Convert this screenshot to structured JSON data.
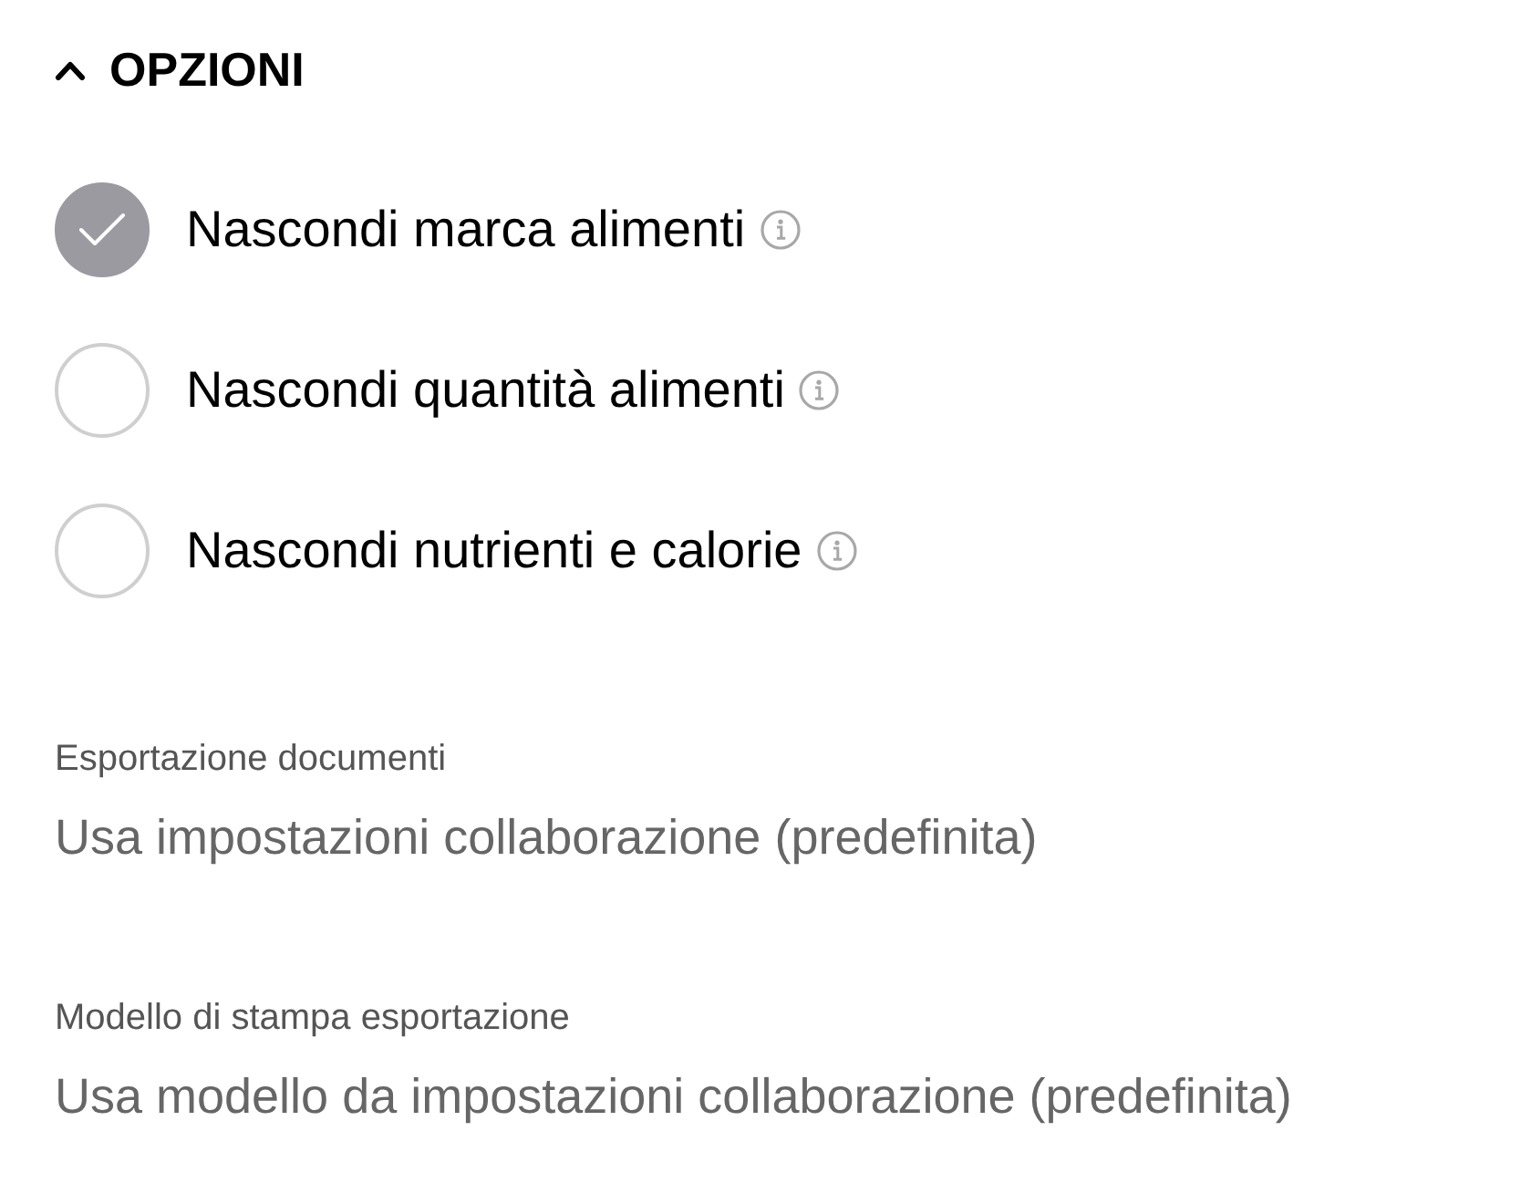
{
  "section": {
    "title": "OPZIONI",
    "expanded": true
  },
  "options": [
    {
      "label": "Nascondi marca alimenti",
      "checked": true
    },
    {
      "label": "Nascondi quantità alimenti",
      "checked": false
    },
    {
      "label": "Nascondi nutrienti e calorie",
      "checked": false
    }
  ],
  "settings": [
    {
      "label": "Esportazione documenti",
      "value": "Usa impostazioni collaborazione (predefinita)"
    },
    {
      "label": "Modello di stampa esportazione",
      "value": "Usa modello da impostazioni collaborazione (predefinita)"
    }
  ]
}
